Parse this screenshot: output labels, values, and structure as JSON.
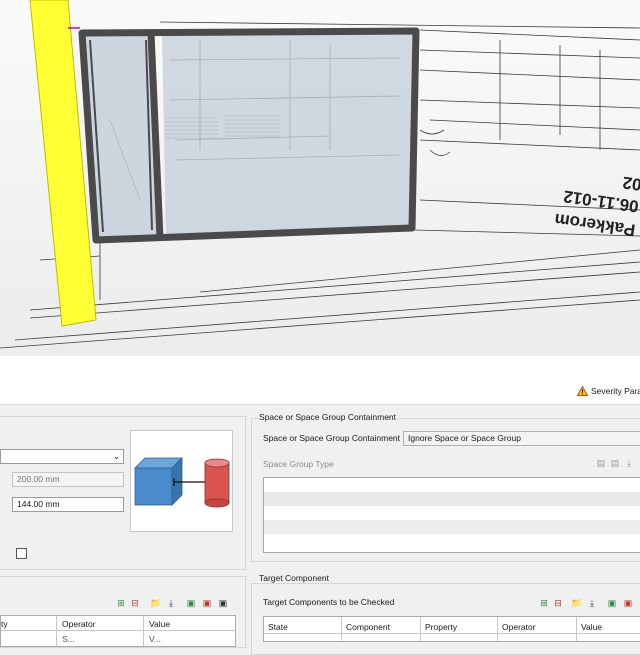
{
  "viewport": {
    "model_text_line1": "Pakkerom",
    "model_text_line2": "06.11-012",
    "model_text_line3": "02"
  },
  "header": {
    "severity_label": "Severity Para"
  },
  "left_panel": {
    "dropdown_value": "",
    "distance_1": "200.00 mm",
    "distance_2": "144.00 mm",
    "table_columns": [
      "ty",
      "Operator",
      "Value"
    ],
    "row_partial": [
      "",
      "S...",
      "V..."
    ]
  },
  "containment": {
    "group_title": "Space or Space Group Containment",
    "label": "Space or Space Group Containment",
    "value": "Ignore Space or Space Group",
    "space_group_type_label": "Space Group Type"
  },
  "target": {
    "group_title": "Target Component",
    "list_title": "Target Components to be Checked",
    "table_columns": [
      "State",
      "Component",
      "Property",
      "Operator",
      "Value"
    ]
  },
  "colors": {
    "yellow_column": "#ffff33",
    "glass": "#c6d0db",
    "frame": "#4a4a4a",
    "box_blue": "#4a8bcc",
    "cyl_red": "#d9534f",
    "accent_green": "#2e8b3c",
    "accent_red": "#c0392b"
  }
}
